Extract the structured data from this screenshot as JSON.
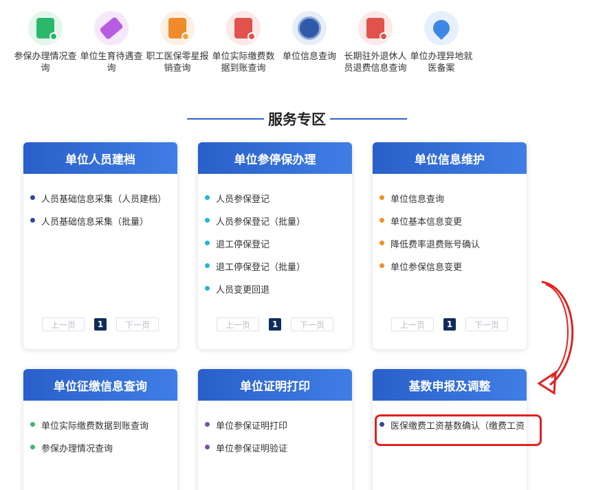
{
  "shortcuts": [
    {
      "label": "参保办理情况查询",
      "icon": "document-search-icon",
      "bg": "#e4f6ec",
      "color": "#2bb86a"
    },
    {
      "label": "单位生育待遇查询",
      "icon": "ticket-icon",
      "bg": "#f6e8fb",
      "color": "#b95de0"
    },
    {
      "label": "职工医保零星报销查询",
      "icon": "receipt-check-icon",
      "bg": "#fdf0e2",
      "color": "#f08a2b"
    },
    {
      "label": "单位实际缴费数据到账查询",
      "icon": "bill-search-icon",
      "bg": "#fde8e8",
      "color": "#e0524b"
    },
    {
      "label": "单位信息查询",
      "icon": "globe-icon",
      "bg": "#e8edf8",
      "color": "#2f5aa8"
    },
    {
      "label": "长期驻外退休人员退费信息查询",
      "icon": "document-search-icon",
      "bg": "#fde8e8",
      "color": "#e0524b"
    },
    {
      "label": "单位办理异地就医备案",
      "icon": "location-pin-icon",
      "bg": "#e6f0fc",
      "color": "#3d88e6"
    }
  ],
  "section_title": "服务专区",
  "cards": [
    {
      "title": "单位人员建档",
      "bullet": "#2f4a9c",
      "items": [
        "人员基础信息采集（人员建档）",
        "人员基础信息采集（批量）"
      ]
    },
    {
      "title": "单位参停保办理",
      "bullet": "#26b6d6",
      "items": [
        "人员参保登记",
        "人员参保登记（批量）",
        "退工停保登记",
        "退工停保登记（批量）",
        "人员变更回退"
      ]
    },
    {
      "title": "单位信息维护",
      "bullet": "#f0902c",
      "items": [
        "单位信息查询",
        "单位基本信息变更",
        "降低费率退费账号确认",
        "单位参保信息变更"
      ]
    },
    {
      "title": "单位征缴信息查询",
      "bullet": "#3fb86c",
      "items": [
        "单位实际缴费数据到账查询",
        "参保办理情况查询"
      ]
    },
    {
      "title": "单位证明打印",
      "bullet": "#7a52a6",
      "items": [
        "单位参保证明打印",
        "单位参保证明验证"
      ]
    },
    {
      "title": "基数申报及调整",
      "bullet": "#2f4a9c",
      "items": [
        "医保缴费工资基数确认（缴费工资"
      ]
    }
  ],
  "pager": {
    "prev": "上一页",
    "page": "1",
    "next": "下一页"
  },
  "annotation_color": "#e1201e"
}
